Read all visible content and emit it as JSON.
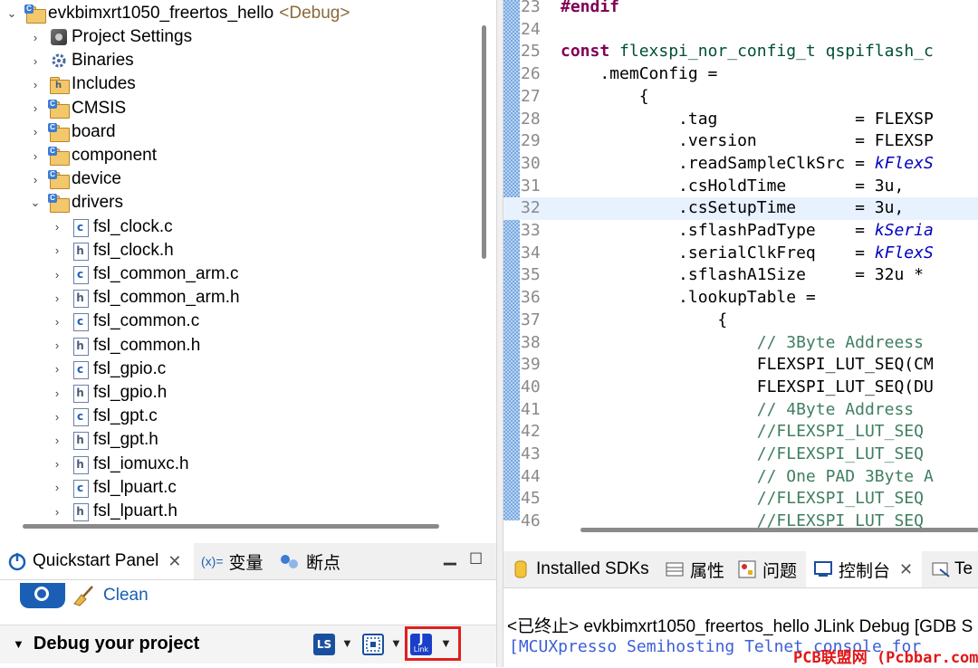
{
  "explorer": {
    "root": {
      "name": "evkbimxrt1050_freertos_hello",
      "tag": "<Debug>"
    },
    "items": [
      {
        "label": "Project Settings",
        "icon": "project-settings-icon"
      },
      {
        "label": "Binaries",
        "icon": "binaries-icon"
      },
      {
        "label": "Includes",
        "icon": "includes-icon"
      },
      {
        "label": "CMSIS",
        "icon": "folder-icon"
      },
      {
        "label": "board",
        "icon": "folder-icon"
      },
      {
        "label": "component",
        "icon": "folder-icon"
      },
      {
        "label": "device",
        "icon": "folder-icon"
      },
      {
        "label": "drivers",
        "icon": "folder-icon"
      }
    ],
    "driver_files": [
      "fsl_clock.c",
      "fsl_clock.h",
      "fsl_common_arm.c",
      "fsl_common_arm.h",
      "fsl_common.c",
      "fsl_common.h",
      "fsl_gpio.c",
      "fsl_gpio.h",
      "fsl_gpt.c",
      "fsl_gpt.h",
      "fsl_iomuxc.h",
      "fsl_lpuart.c",
      "fsl_lpuart.h"
    ]
  },
  "editor": {
    "lines": [
      {
        "n": "23",
        "t": "#endif"
      },
      {
        "n": "24",
        "t": ""
      },
      {
        "n": "25",
        "t": "const flexspi_nor_config_t qspiflash_c"
      },
      {
        "n": "26",
        "t": "    .memConfig ="
      },
      {
        "n": "27",
        "t": "        {"
      },
      {
        "n": "28",
        "t": "            .tag              = FLEXSP"
      },
      {
        "n": "29",
        "t": "            .version          = FLEXSP"
      },
      {
        "n": "30",
        "t": "            .readSampleClkSrc = kFlexS"
      },
      {
        "n": "31",
        "t": "            .csHoldTime       = 3u,"
      },
      {
        "n": "32",
        "t": "            .csSetupTime      = 3u,"
      },
      {
        "n": "33",
        "t": "            .sflashPadType    = kSeria"
      },
      {
        "n": "34",
        "t": "            .serialClkFreq    = kFlexS"
      },
      {
        "n": "35",
        "t": "            .sflashA1Size     = 32u *"
      },
      {
        "n": "36",
        "t": "            .lookupTable ="
      },
      {
        "n": "37",
        "t": "                {"
      },
      {
        "n": "38",
        "t": "                    // 3Byte Addreess"
      },
      {
        "n": "39",
        "t": "                    FLEXSPI_LUT_SEQ(CM"
      },
      {
        "n": "40",
        "t": "                    FLEXSPI_LUT_SEQ(DU"
      },
      {
        "n": "41",
        "t": "                    // 4Byte Address"
      },
      {
        "n": "42",
        "t": "                    //FLEXSPI_LUT_SEQ"
      },
      {
        "n": "43",
        "t": "                    //FLEXSPI_LUT_SEQ"
      },
      {
        "n": "44",
        "t": "                    // One PAD 3Byte A"
      },
      {
        "n": "45",
        "t": "                    //FLEXSPI_LUT_SEQ"
      },
      {
        "n": "46",
        "t": "                    //FLEXSPI_LUT_SEQ"
      }
    ]
  },
  "quickstart": {
    "tabs": {
      "quickstart": "Quickstart Panel",
      "variables_prefix": "(x)=",
      "variables": "变量",
      "breakpoints": "断点"
    },
    "clean_label": "Clean",
    "debug_title": "Debug your project",
    "ls_icon_text": "LS",
    "jlink_icon_text": "J"
  },
  "console": {
    "tabs": {
      "installed_sdks": "Installed SDKs",
      "properties": "属性",
      "problems": "问题",
      "console": "控制台",
      "terminal": "Te"
    },
    "status": "<已终止> evkbimxrt1050_freertos_hello JLink Debug [GDB S",
    "line": "[MCUXpresso Semihosting Telnet console for",
    "watermark": "PCB联盟网 (Pcbbar.com)"
  }
}
